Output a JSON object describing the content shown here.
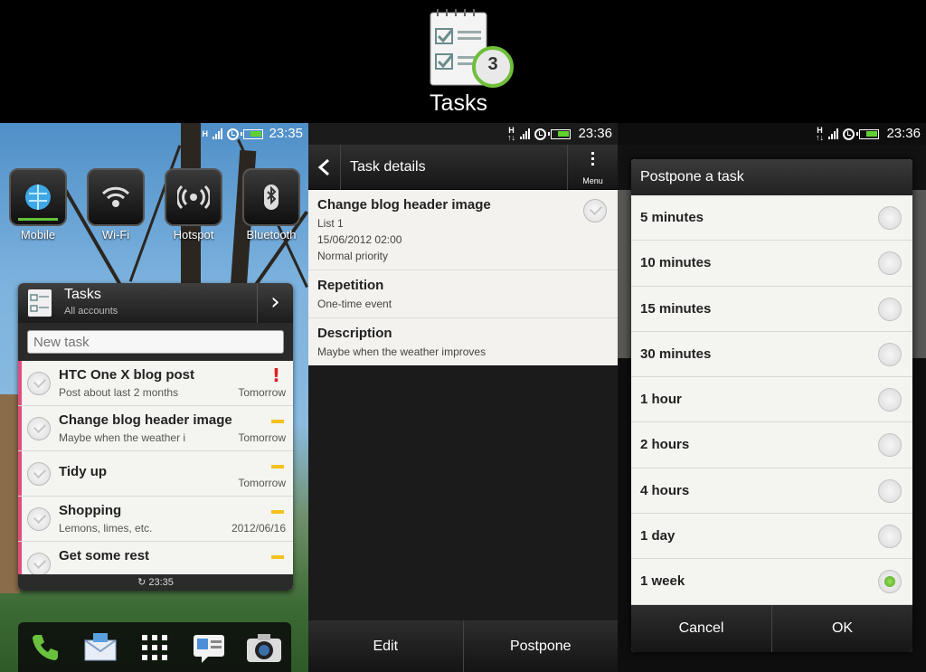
{
  "header": {
    "app_title": "Tasks",
    "badge_count": "3"
  },
  "status_bars": [
    {
      "time": "23:35"
    },
    {
      "time": "23:36"
    },
    {
      "time": "23:36"
    }
  ],
  "home": {
    "quick_settings": [
      {
        "label": "Mobile",
        "icon": "mobile-data-icon",
        "on": true
      },
      {
        "label": "Wi-Fi",
        "icon": "wifi-icon",
        "on": false
      },
      {
        "label": "Hotspot",
        "icon": "hotspot-icon",
        "on": false
      },
      {
        "label": "Bluetooth",
        "icon": "bluetooth-icon",
        "on": false
      }
    ],
    "widget": {
      "title": "Tasks",
      "subtitle": "All accounts",
      "new_task_placeholder": "New task",
      "tasks": [
        {
          "title": "HTC One X blog post",
          "note": "Post about last 2 months",
          "date": "Tomorrow",
          "priority": "high"
        },
        {
          "title": "Change blog header image",
          "note": "Maybe when the weather improves",
          "date": "Tomorrow",
          "priority": "normal"
        },
        {
          "title": "Tidy up",
          "note": "",
          "date": "Tomorrow",
          "priority": "normal"
        },
        {
          "title": "Shopping",
          "note": "Lemons, limes, etc.",
          "date": "2012/06/16",
          "priority": "normal"
        },
        {
          "title": "Get some rest",
          "note": "",
          "date": "",
          "priority": "normal"
        }
      ],
      "footer_time": "23:35"
    },
    "dock": [
      "phone-icon",
      "mail-icon",
      "app-drawer-icon",
      "messages-icon",
      "camera-icon"
    ]
  },
  "details": {
    "title": "Task details",
    "menu_label": "Menu",
    "task": {
      "title": "Change blog header image",
      "list": "List 1",
      "due": "15/06/2012 02:00",
      "priority": "Normal priority"
    },
    "repetition": {
      "heading": "Repetition",
      "value": "One-time event"
    },
    "description": {
      "heading": "Description",
      "value": "Maybe when the weather improves"
    },
    "buttons": {
      "edit": "Edit",
      "postpone": "Postpone"
    }
  },
  "postpone": {
    "title": "Postpone a task",
    "options": [
      {
        "label": "5 minutes",
        "selected": false
      },
      {
        "label": "10 minutes",
        "selected": false
      },
      {
        "label": "15 minutes",
        "selected": false
      },
      {
        "label": "30 minutes",
        "selected": false
      },
      {
        "label": "1 hour",
        "selected": false
      },
      {
        "label": "2 hours",
        "selected": false
      },
      {
        "label": "4 hours",
        "selected": false
      },
      {
        "label": "1 day",
        "selected": false
      },
      {
        "label": "1 week",
        "selected": true
      }
    ],
    "cancel": "Cancel",
    "ok": "OK"
  },
  "colors": {
    "accent_green": "#5fd12f",
    "priority_high": "#e01e1e",
    "priority_normal": "#f2c21d",
    "task_stripe": "#e04d7f"
  }
}
